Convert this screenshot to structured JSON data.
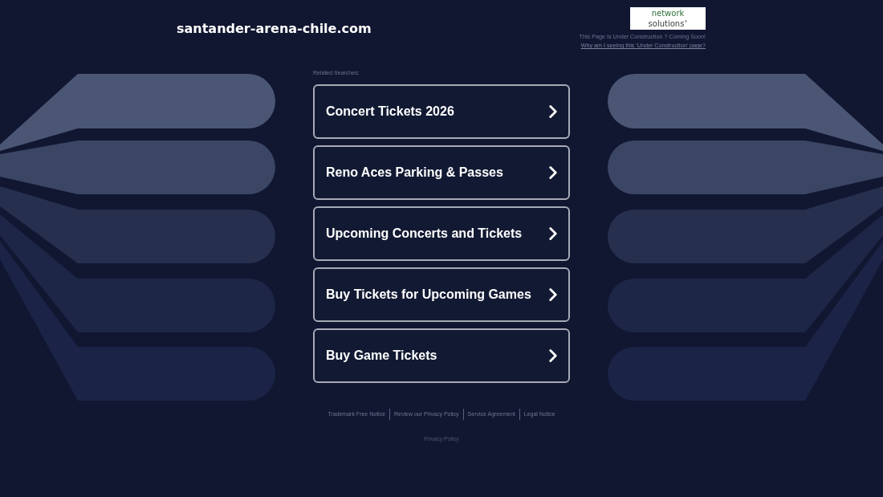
{
  "header": {
    "domain": "santander-arena-chile.com",
    "logo": {
      "line_1": "network",
      "line_2": "solutions$^{®}$"
    },
    "notice": "This Page Is Under Construction ? Coming Soon!",
    "notice_link": "Why am I seeing this 'Under Construction' page?"
  },
  "related_searches": {
    "heading": "Related Searches:",
    "items": [
      "Concert Tickets 2026",
      "Reno Aces Parking & Passes",
      "Upcoming Concerts and Tickets",
      "Buy Tickets for Upcoming Games",
      "Buy Game Tickets"
    ]
  },
  "footer": {
    "links": [
      "Trademark Free Notice",
      "Review our Privacy Policy",
      "Service Agreement",
      "Legal Notice"
    ],
    "privacy_link": "Privacy Policy"
  }
}
